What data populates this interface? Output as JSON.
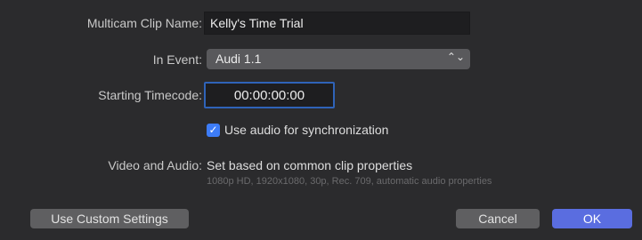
{
  "form": {
    "clip_name_label": "Multicam Clip Name:",
    "clip_name_value": "Kelly's Time Trial",
    "event_label": "In Event:",
    "event_value": "Audi 1.1",
    "timecode_label": "Starting Timecode:",
    "timecode_value": "00:00:00:00",
    "sync_label": "Use audio for synchronization",
    "sync_checked": true,
    "video_audio_label": "Video and Audio:",
    "video_audio_value": "Set based on common clip properties",
    "video_audio_detail": "1080p HD, 1920x1080, 30p, Rec. 709, automatic audio properties"
  },
  "buttons": {
    "custom_label": "Use Custom Settings",
    "cancel_label": "Cancel",
    "ok_label": "OK"
  },
  "icons": {
    "select_chevron": "chevron-up-down-icon",
    "checkbox": "checkmark-icon"
  },
  "colors": {
    "background": "#2b2b2d",
    "accent": "#3d7cf7",
    "ok_button": "#5a6de0"
  }
}
